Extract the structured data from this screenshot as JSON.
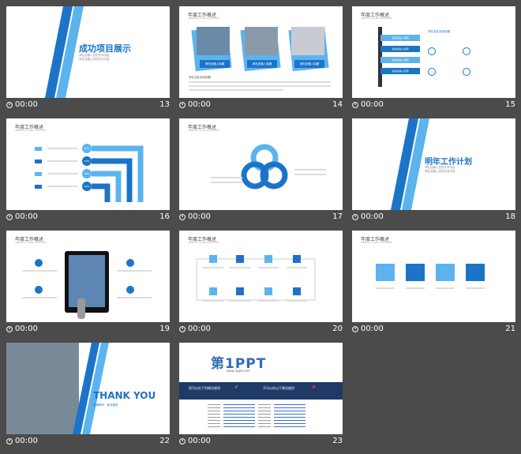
{
  "slides": [
    {
      "num": "13",
      "timer": "00:00",
      "title": "成功项目展示",
      "line1": "请在此输入您的文本内容",
      "line2": "请在此输入您的文本内容"
    },
    {
      "num": "14",
      "timer": "00:00",
      "title": "年度工作概述",
      "sub": "ANNUAL WORK OVERVIEW",
      "caps": [
        "请在此输入标题",
        "请在此输入标题",
        "请在此输入标题"
      ],
      "body_title": "请在此处添加标题"
    },
    {
      "num": "15",
      "timer": "00:00",
      "title": "年度工作概述",
      "sub": "ANNUAL WORK OVERVIEW",
      "steps": [
        "请在此输入标题",
        "请在此输入标题",
        "请在此输入标题",
        "请在此输入标题"
      ],
      "head": "请在此处添加标题"
    },
    {
      "num": "16",
      "timer": "00:00",
      "title": "年度工作概述",
      "sub": "ANNUAL WORK OVERVIEW",
      "pcts": [
        "40%",
        "60%",
        "80%",
        "90%"
      ]
    },
    {
      "num": "17",
      "timer": "00:00",
      "title": "年度工作概述",
      "sub": "ANNUAL WORK OVERVIEW"
    },
    {
      "num": "18",
      "timer": "00:00",
      "title": "明年工作计划",
      "line1": "请在此输入您的文本内容",
      "line2": "请在此输入您的文本内容"
    },
    {
      "num": "19",
      "timer": "00:00",
      "title": "年度工作概述",
      "sub": "ANNUAL WORK OVERVIEW"
    },
    {
      "num": "20",
      "timer": "00:00",
      "title": "年度工作概述",
      "sub": "ANNUAL WORK OVERVIEW"
    },
    {
      "num": "21",
      "timer": "00:00",
      "title": "年度工作概述",
      "sub": "ANNUAL WORK OVERVIEW"
    },
    {
      "num": "22",
      "timer": "00:00",
      "title": "THANK YOU",
      "line1": "感谢聆听 · 批评指导"
    },
    {
      "num": "23",
      "timer": "00:00",
      "logo_main": "第1PPT",
      "logo_url": "www.1ppt.com",
      "bar_left": "您可以在下列情况使用",
      "bar_right": "不可以在以下情况使用"
    }
  ],
  "colors": {
    "bg": "#4b4b4b",
    "accent": "#1c74c8",
    "light": "#5cb4ee",
    "navy": "#1f3a66"
  }
}
